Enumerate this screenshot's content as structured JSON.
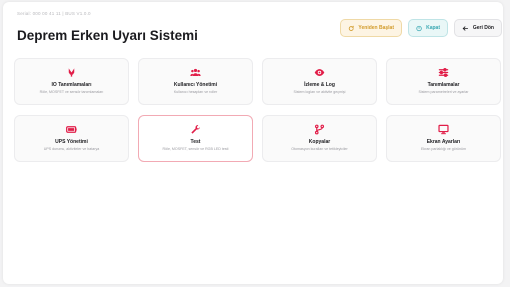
{
  "header": {
    "serial": "Serial: 000 00 41 11  |  BUS V1.0.0",
    "title": "Deprem Erken Uyarı Sistemi"
  },
  "toolbar": {
    "restart_label": "Yeniden Başlat",
    "close_label": "Kapat",
    "back_label": "Geri Dön"
  },
  "colors": {
    "accent": "#e11d48",
    "restart": "#d29c2c",
    "close": "#3aa8b3"
  },
  "cards": [
    {
      "label": "IO Tanımlamaları",
      "sub": "Röle, MOSFET ve sensör tanımlamaları",
      "icon": "chip-icon"
    },
    {
      "label": "Kullanıcı Yönetimi",
      "sub": "Kullanıcı hesapları ve roller",
      "icon": "users-icon"
    },
    {
      "label": "İzleme & Log",
      "sub": "Sistem logları ve aktivite geçmişi",
      "icon": "eye-icon"
    },
    {
      "label": "Tanımlamalar",
      "sub": "Sistem parametreleri ve ayarlar",
      "icon": "sliders-icon"
    },
    {
      "label": "UPS Yönetimi",
      "sub": "UPS durumu, aktiviteler ve batarya",
      "icon": "battery-icon"
    },
    {
      "label": "Test",
      "sub": "Röle, MOSFET, sensör ve RGB LED testi",
      "icon": "wrench-icon"
    },
    {
      "label": "Kopyalar",
      "sub": "Otomasyon kuralları ve tetikleyiciler",
      "icon": "flow-icon"
    },
    {
      "label": "Ekran Ayarları",
      "sub": "Ekran parlaklığı ve görünüm",
      "icon": "monitor-icon"
    }
  ]
}
